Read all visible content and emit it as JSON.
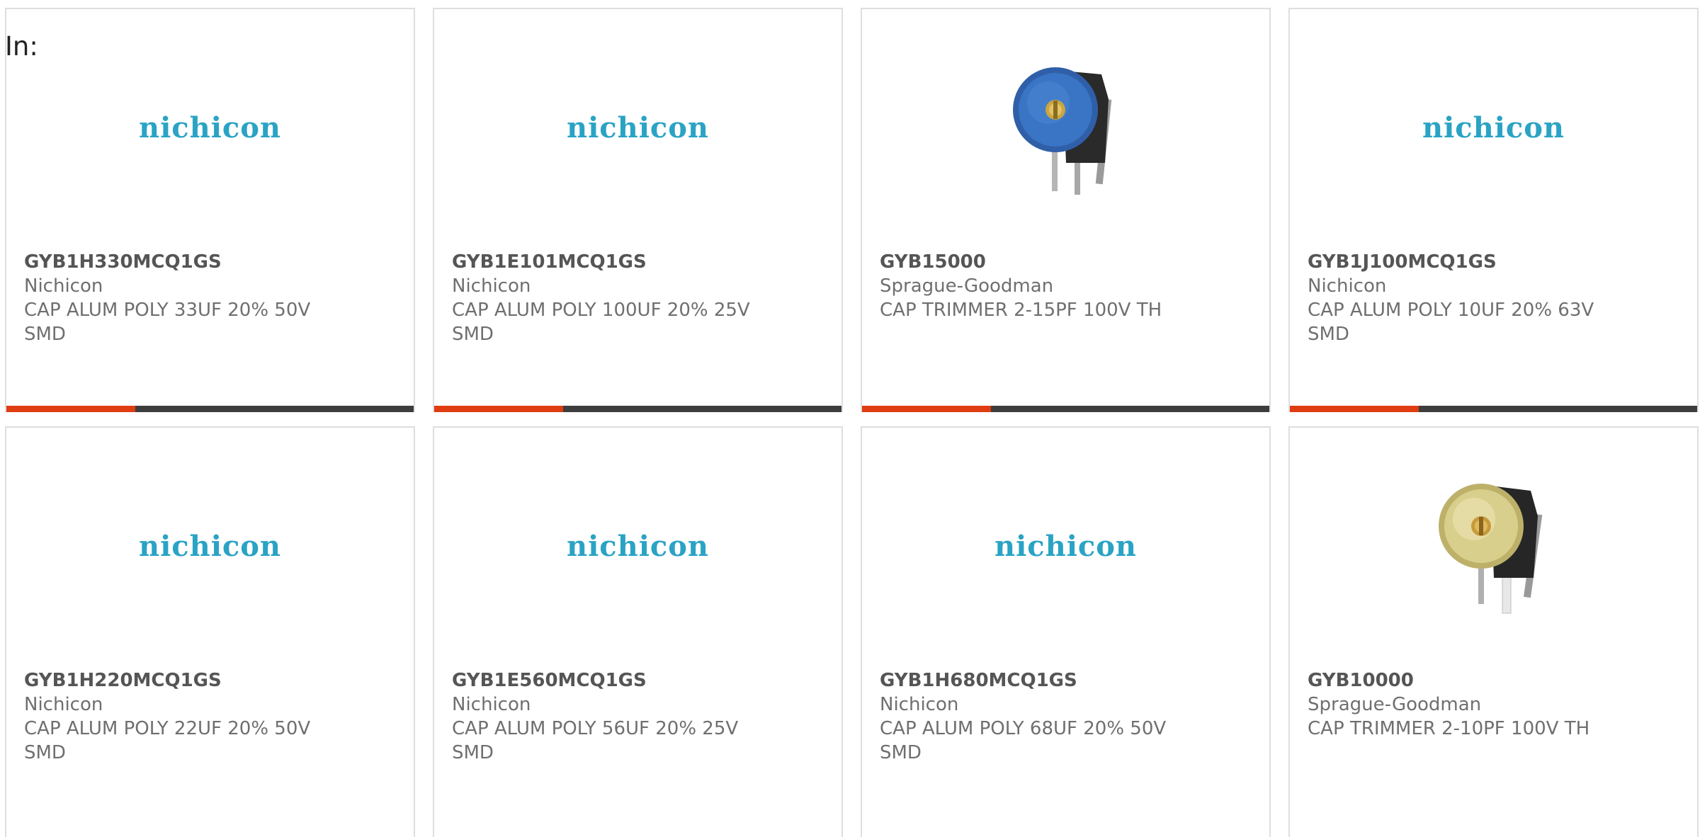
{
  "filter": {
    "label": "In:"
  },
  "products": [
    {
      "part_number": "GYB1H330MCQ1GS",
      "manufacturer": "Nichicon",
      "description": "CAP ALUM POLY 33UF 20% 50V SMD",
      "image": "nichicon-logo",
      "logo_text": "nichicon"
    },
    {
      "part_number": "GYB1E101MCQ1GS",
      "manufacturer": "Nichicon",
      "description": "CAP ALUM POLY 100UF 20% 25V SMD",
      "image": "nichicon-logo",
      "logo_text": "nichicon"
    },
    {
      "part_number": "GYB15000",
      "manufacturer": "Sprague-Goodman",
      "description": "CAP TRIMMER 2-15PF 100V TH",
      "image": "blue-trimmer-capacitor-photo"
    },
    {
      "part_number": "GYB1J100MCQ1GS",
      "manufacturer": "Nichicon",
      "description": "CAP ALUM POLY 10UF 20% 63V SMD",
      "image": "nichicon-logo",
      "logo_text": "nichicon"
    },
    {
      "part_number": "GYB1H220MCQ1GS",
      "manufacturer": "Nichicon",
      "description": "CAP ALUM POLY 22UF 20% 50V SMD",
      "image": "nichicon-logo",
      "logo_text": "nichicon"
    },
    {
      "part_number": "GYB1E560MCQ1GS",
      "manufacturer": "Nichicon",
      "description": "CAP ALUM POLY 56UF 20% 25V SMD",
      "image": "nichicon-logo",
      "logo_text": "nichicon"
    },
    {
      "part_number": "GYB1H680MCQ1GS",
      "manufacturer": "Nichicon",
      "description": "CAP ALUM POLY 68UF 20% 50V SMD",
      "image": "nichicon-logo",
      "logo_text": "nichicon"
    },
    {
      "part_number": "GYB10000",
      "manufacturer": "Sprague-Goodman",
      "description": "CAP TRIMMER 2-10PF 100V TH",
      "image": "yellow-trimmer-capacitor-photo"
    }
  ],
  "colors": {
    "accent_bar": "#e03c12",
    "bar_track": "#3d3d3d",
    "logo": "#2aa3c4",
    "card_border": "#dedede",
    "text": "#6f6f6f"
  }
}
